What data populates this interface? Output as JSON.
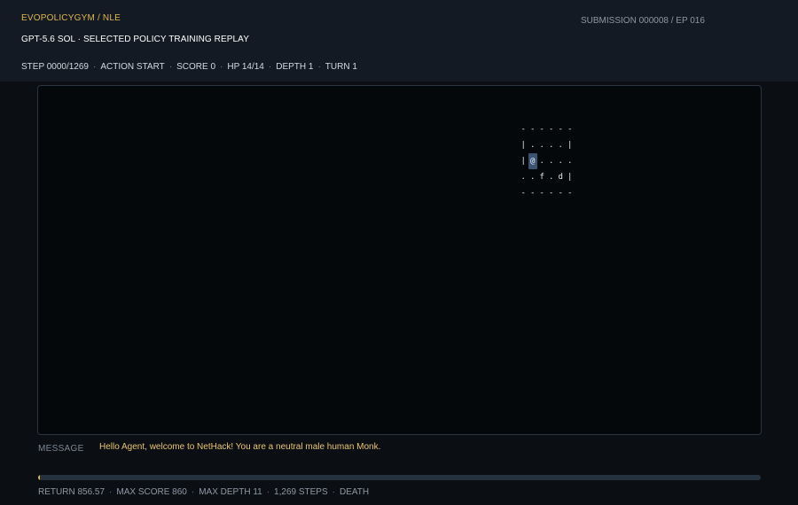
{
  "header": {
    "brand": "EVOPOLICYGYM / NLE",
    "subtitle": "GPT-5.6 SOL · SELECTED POLICY TRAINING REPLAY",
    "submission": "SUBMISSION 000008 / EP 016"
  },
  "status": {
    "step": "STEP 0000/1269",
    "action": "ACTION START",
    "score": "SCORE 0",
    "hp": "HP 14/14",
    "depth": "DEPTH 1",
    "turn": "TURN 1",
    "separator": "·"
  },
  "map": {
    "rows": [
      [
        "-",
        "-",
        "-",
        "-",
        "-",
        "-"
      ],
      [
        "|",
        ".",
        ".",
        ".",
        ".",
        "|"
      ],
      [
        "|",
        "@",
        ".",
        ".",
        ".",
        "."
      ],
      [
        ".",
        ".",
        "f",
        ".",
        "d",
        "|"
      ],
      [
        "-",
        "-",
        "-",
        "-",
        "-",
        "-"
      ]
    ],
    "player_glyph": "@"
  },
  "message": {
    "label": "MESSAGE",
    "text": "Hello Agent, welcome to NetHack! You are a neutral male human Monk."
  },
  "progress": {
    "fraction": 0.0008
  },
  "footer": {
    "return": "RETURN 856.57",
    "max_score": "MAX SCORE 860",
    "max_depth": "MAX DEPTH 11",
    "steps": "1,269 STEPS",
    "outcome": "DEATH",
    "separator": "·"
  },
  "colors": {
    "accent": "#e0b64f",
    "background": "#0b0f14",
    "header_bg": "#131a23",
    "player_highlight": "#3a5370"
  }
}
